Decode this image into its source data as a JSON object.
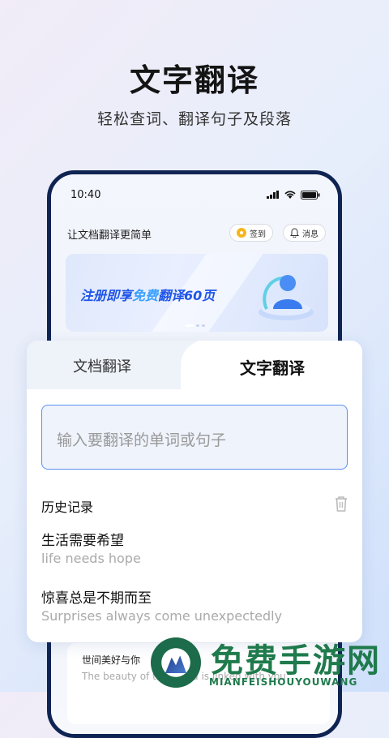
{
  "hero": {
    "title": "文字翻译",
    "subtitle": "轻松查词、翻译句子及段落"
  },
  "phone": {
    "status_time": "10:40",
    "app_title": "让文档翻译更简单",
    "signin_label": "签到",
    "message_label": "消息",
    "banner": {
      "text_prefix": "注册即享",
      "text_highlight": "免费",
      "text_suffix": "翻译60页"
    },
    "bg_list": {
      "cn": "世间美好与你",
      "en": "The beauty of the world is linked with you"
    }
  },
  "card": {
    "tabs": [
      {
        "label": "文档翻译",
        "active": false
      },
      {
        "label": "文字翻译",
        "active": true
      }
    ],
    "input_placeholder": "输入要翻译的单词或句子",
    "history_title": "历史记录",
    "history": [
      {
        "cn": "生活需要希望",
        "en": "life needs hope"
      },
      {
        "cn": "惊喜总是不期而至",
        "en": "Surprises always come unexpectedly"
      }
    ]
  },
  "watermark": {
    "cn": "免费手游网",
    "en": "MIANFEISHOUYOUWANG"
  },
  "colors": {
    "accent": "#1f55e8",
    "frame": "#0f2452",
    "input_border": "#5b8ff0"
  }
}
